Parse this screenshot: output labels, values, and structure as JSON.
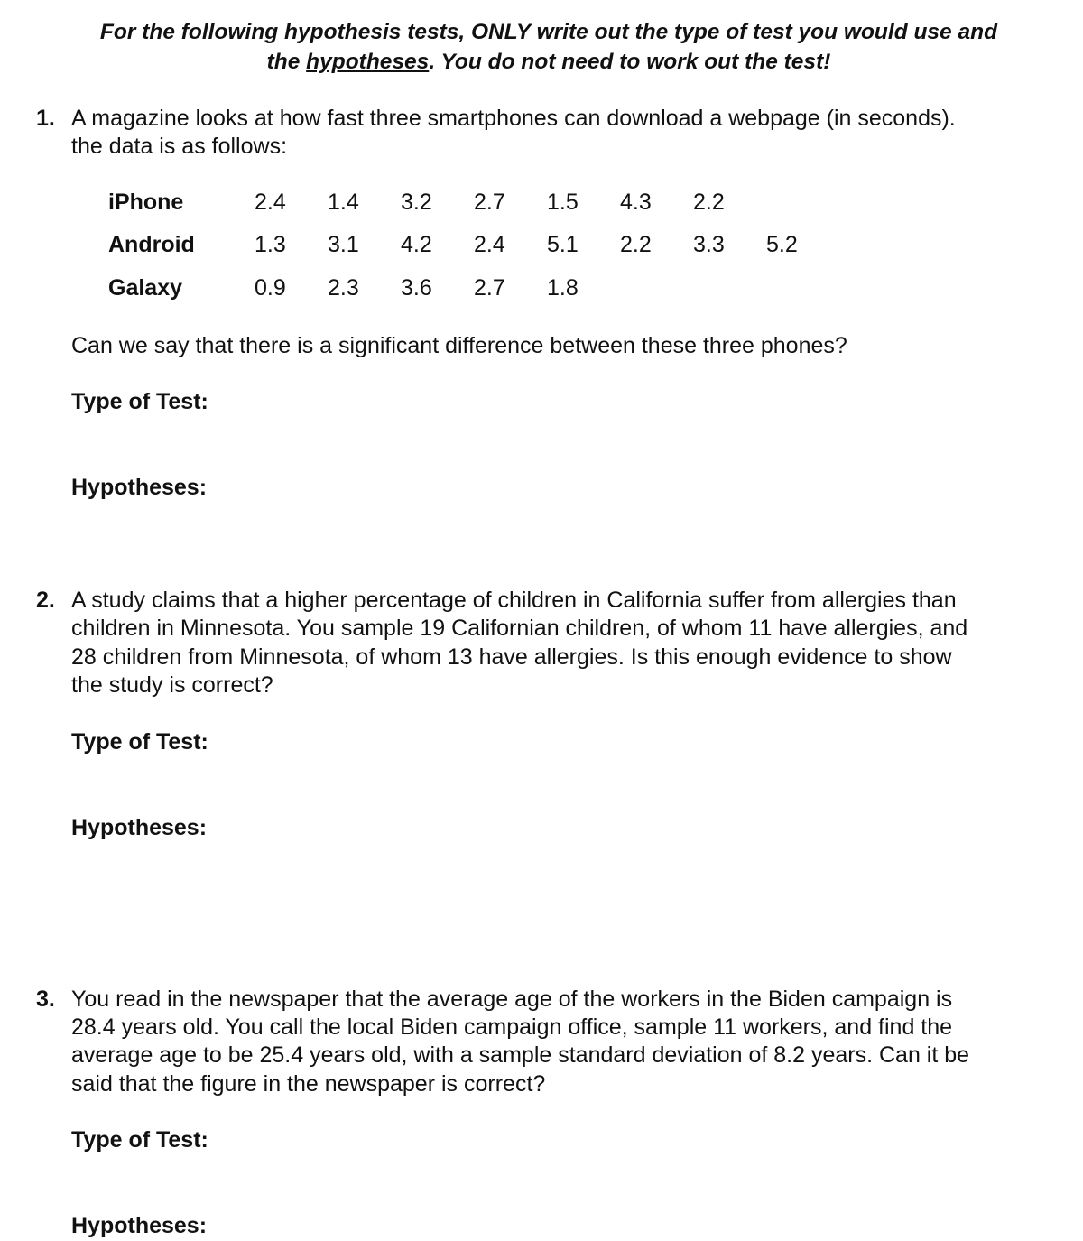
{
  "header": {
    "line1": "For the following hypothesis tests, ONLY write out the type of test you would use and",
    "line2_pre": "the ",
    "line2_underlined": "hypotheses",
    "line2_post": ". You do not need to work out the test!"
  },
  "questions": [
    {
      "number": "1.",
      "lines": [
        "A magazine looks at how fast three smartphones can download a webpage (in seconds).",
        "the data is as follows:"
      ],
      "table": [
        {
          "label": "iPhone",
          "values": [
            "2.4",
            "1.4",
            "3.2",
            "2.7",
            "1.5",
            "4.3",
            "2.2"
          ]
        },
        {
          "label": "Android",
          "values": [
            "1.3",
            "3.1",
            "4.2",
            "2.4",
            "5.1",
            "2.2",
            "3.3",
            "5.2"
          ]
        },
        {
          "label": "Galaxy",
          "values": [
            "0.9",
            "2.3",
            "3.6",
            "2.7",
            "1.8"
          ]
        }
      ],
      "question": "Can we say that there is a significant difference between these three phones?",
      "type_label": "Type of Test:",
      "hyp_label": "Hypotheses:"
    },
    {
      "number": "2.",
      "lines": [
        "A study claims that a higher percentage of children in California suffer from allergies than",
        "children in Minnesota. You sample 19 Californian children, of whom 11 have allergies, and",
        "28 children from Minnesota, of whom 13 have allergies. Is this enough evidence to show",
        "the study is correct?"
      ],
      "type_label": "Type of Test:",
      "hyp_label": "Hypotheses:"
    },
    {
      "number": "3.",
      "lines": [
        "You read in the newspaper that the average age of the workers in the Biden campaign is",
        "28.4 years old. You call the local Biden campaign office, sample 11 workers, and find the",
        "average age to be 25.4 years old, with a sample standard deviation of 8.2 years. Can it be",
        "said that the figure in the newspaper is correct?"
      ],
      "type_label": "Type of Test:",
      "hyp_label": "Hypotheses:"
    }
  ]
}
